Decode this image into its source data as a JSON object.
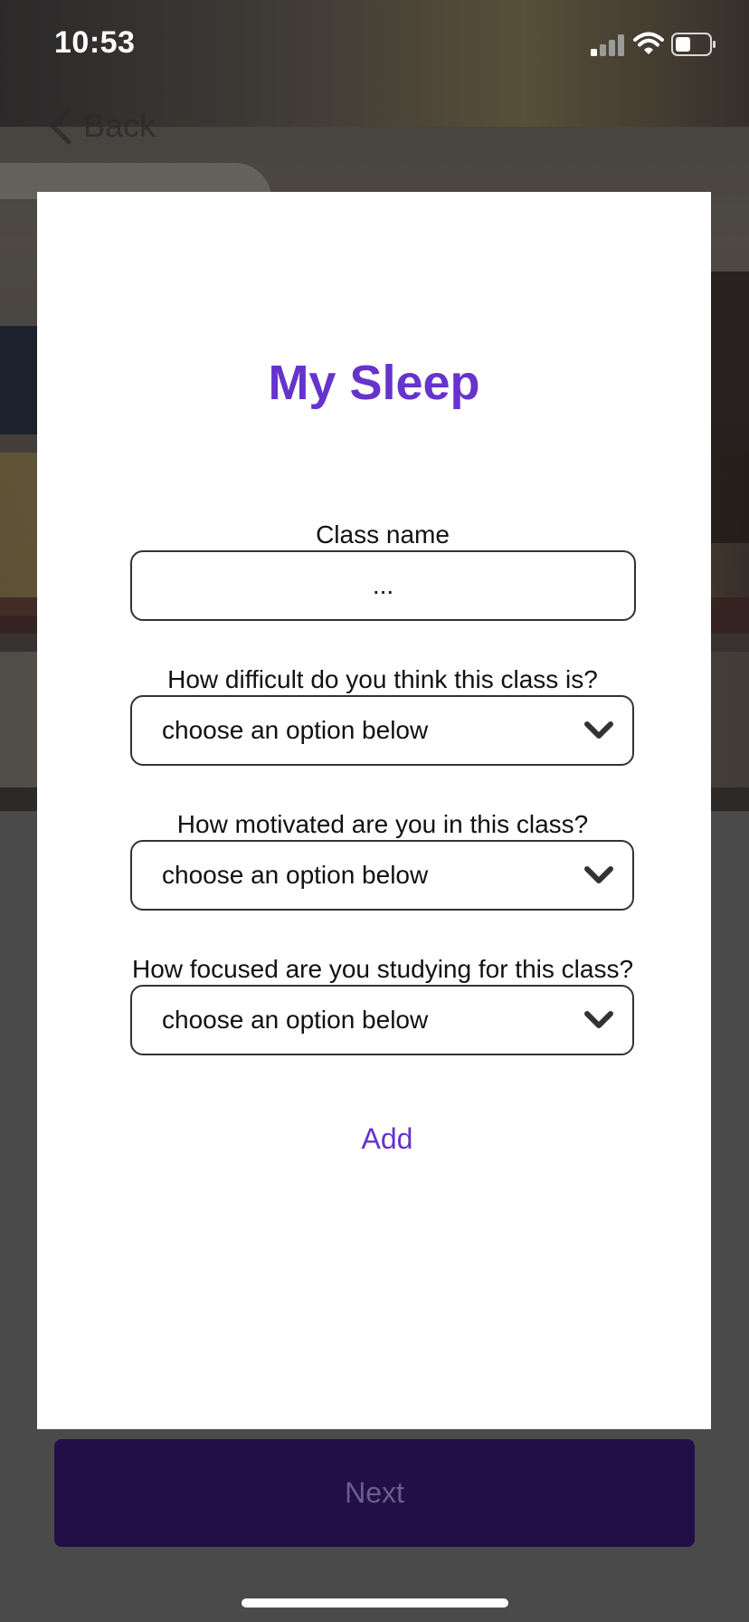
{
  "status_bar": {
    "time": "10:53",
    "icons": [
      "signal-icon",
      "wifi-icon",
      "battery-icon"
    ]
  },
  "nav": {
    "back_label": "Back",
    "back_icon": "chevron-left-icon"
  },
  "card": {
    "title": "My Sleep",
    "class_name": {
      "label": "Class name",
      "value": "..."
    },
    "questions": [
      {
        "label": "How difficult do you think this class is?",
        "selected": "choose an option below"
      },
      {
        "label": "How motivated are you in this class?",
        "selected": "choose an option below"
      },
      {
        "label": "How focused are you studying for this class?",
        "selected": "choose an option below"
      }
    ],
    "add_label": "Add"
  },
  "footer": {
    "next_label": "Next"
  },
  "colors": {
    "accent": "#6633cc",
    "next_button": "#220f48",
    "next_text": "#6c5d8a",
    "backdrop": "#4a4a4b"
  }
}
